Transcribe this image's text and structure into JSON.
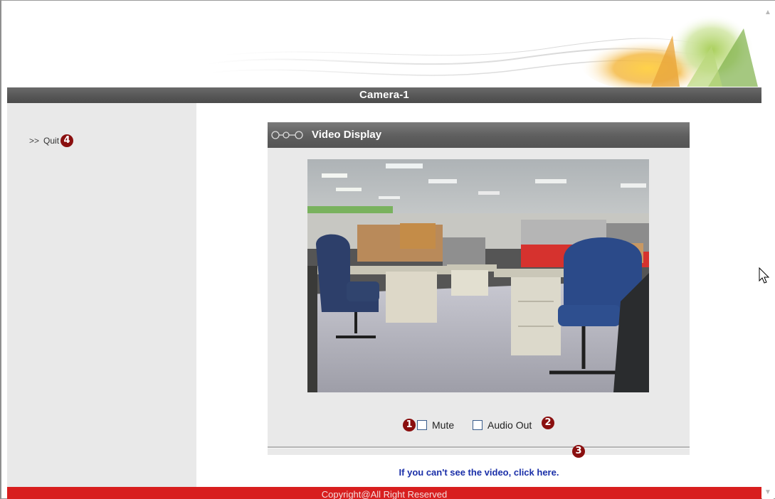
{
  "header": {
    "title": "Camera-1"
  },
  "sidebar": {
    "quit": {
      "arrows": ">>",
      "label": "Quit",
      "badge": "4"
    }
  },
  "video_panel": {
    "title": "Video Display",
    "controls": {
      "mute_label": "Mute",
      "audio_out_label": "Audio Out",
      "badge_mute": "1",
      "badge_audio": "2"
    },
    "help_badge": "3",
    "help_link": "If you can't see the video, click here."
  },
  "footer": {
    "copyright": "Copyright@All Right Reserved"
  },
  "colors": {
    "title_bar": "#555555",
    "footer": "#d81e1e",
    "badge": "#8a0f0f",
    "link": "#1a2fa8"
  }
}
